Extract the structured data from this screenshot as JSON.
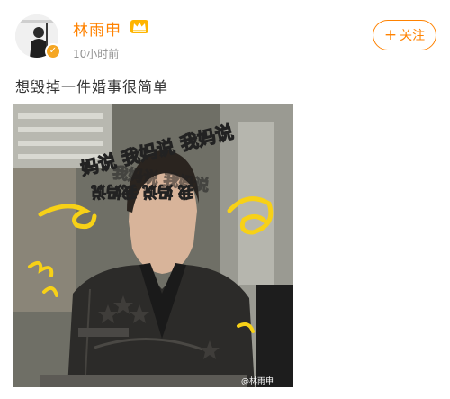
{
  "user": {
    "name": "林雨申",
    "time": "10小时前",
    "verified_color": "#f5a623",
    "badge_icon": "vip-crown-icon"
  },
  "follow_button": {
    "icon": "plus-icon",
    "plus": "+",
    "label": "关注"
  },
  "post": {
    "text": "想毁掉一件婚事很简单",
    "image_overlay_lines": [
      "妈说 我妈说 我妈说",
      "我妈说 我妈说",
      "我 妈说 我妈说"
    ],
    "watermark": "@林雨申"
  },
  "colors": {
    "accent": "#ff8200",
    "overlay_yellow": "#f7d117"
  }
}
